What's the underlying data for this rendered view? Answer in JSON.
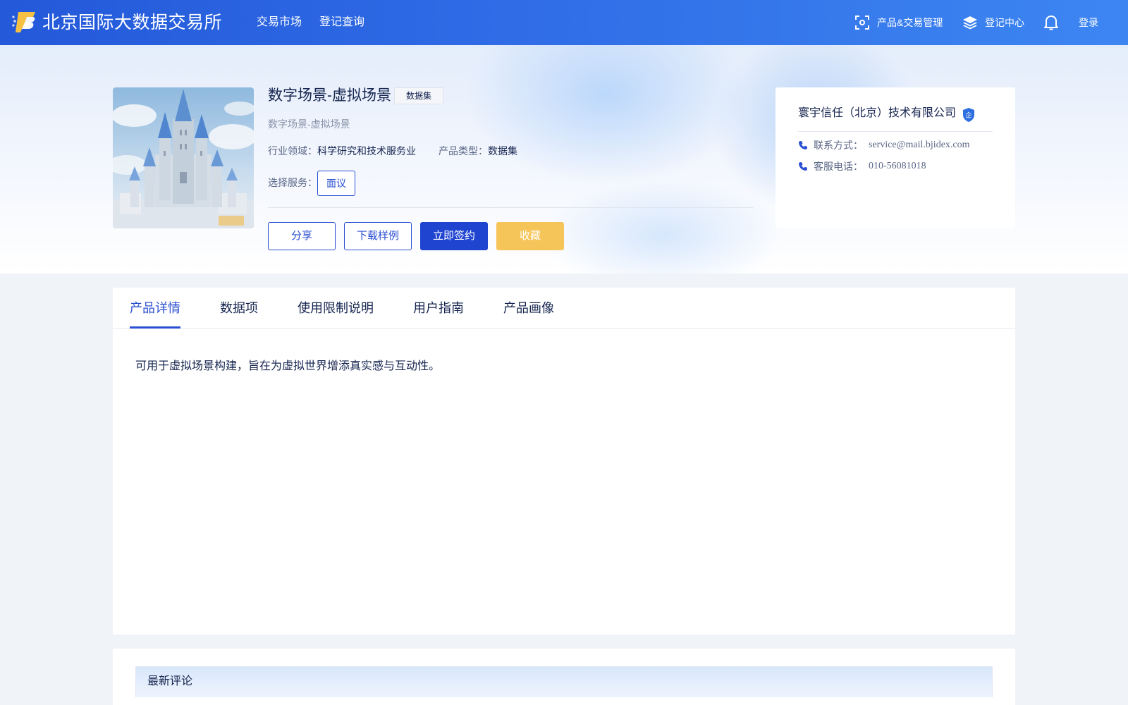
{
  "header": {
    "brand": "北京国际大数据交易所",
    "nav": [
      "交易市场",
      "登记查询"
    ],
    "product_trade_mgmt": "产品&交易管理",
    "registry_center": "登记中心",
    "login": "登录"
  },
  "product": {
    "title": "数字场景-虚拟场景",
    "tag": "数据集",
    "subtitle": "数字场景-虚拟场景",
    "industry_label": "行业领域：",
    "industry_value": "科学研究和技术服务业",
    "type_label": "产品类型：",
    "type_value": "数据集",
    "service_label": "选择服务：",
    "service_option": "面议",
    "buttons": {
      "share": "分享",
      "download_sample": "下载样例",
      "sign_now": "立即签约",
      "favorite": "收藏"
    }
  },
  "company": {
    "name": "寰宇信任（北京）技术有限公司",
    "badge": "企",
    "contact_label": "联系方式：",
    "contact_value": "service@mail.bjidex.com",
    "phone_label": "客服电话：",
    "phone_value": "010-56081018"
  },
  "tabs": [
    "产品详情",
    "数据项",
    "使用限制说明",
    "用户指南",
    "产品画像"
  ],
  "active_tab": "产品详情",
  "detail_text": "可用于虚拟场景构建，旨在为虚拟世界增添真实感与互动性。",
  "comments": {
    "title": "最新评论"
  },
  "colors": {
    "header_start": "#2459d9",
    "header_end": "#3d86f2",
    "primary": "#2a4fd1",
    "gold": "#f6c55a",
    "text_dark": "#16254f"
  },
  "icons": [
    "logo-icon",
    "scan-icon",
    "layers-icon",
    "bell-icon",
    "phone-icon",
    "verified-badge-icon"
  ]
}
